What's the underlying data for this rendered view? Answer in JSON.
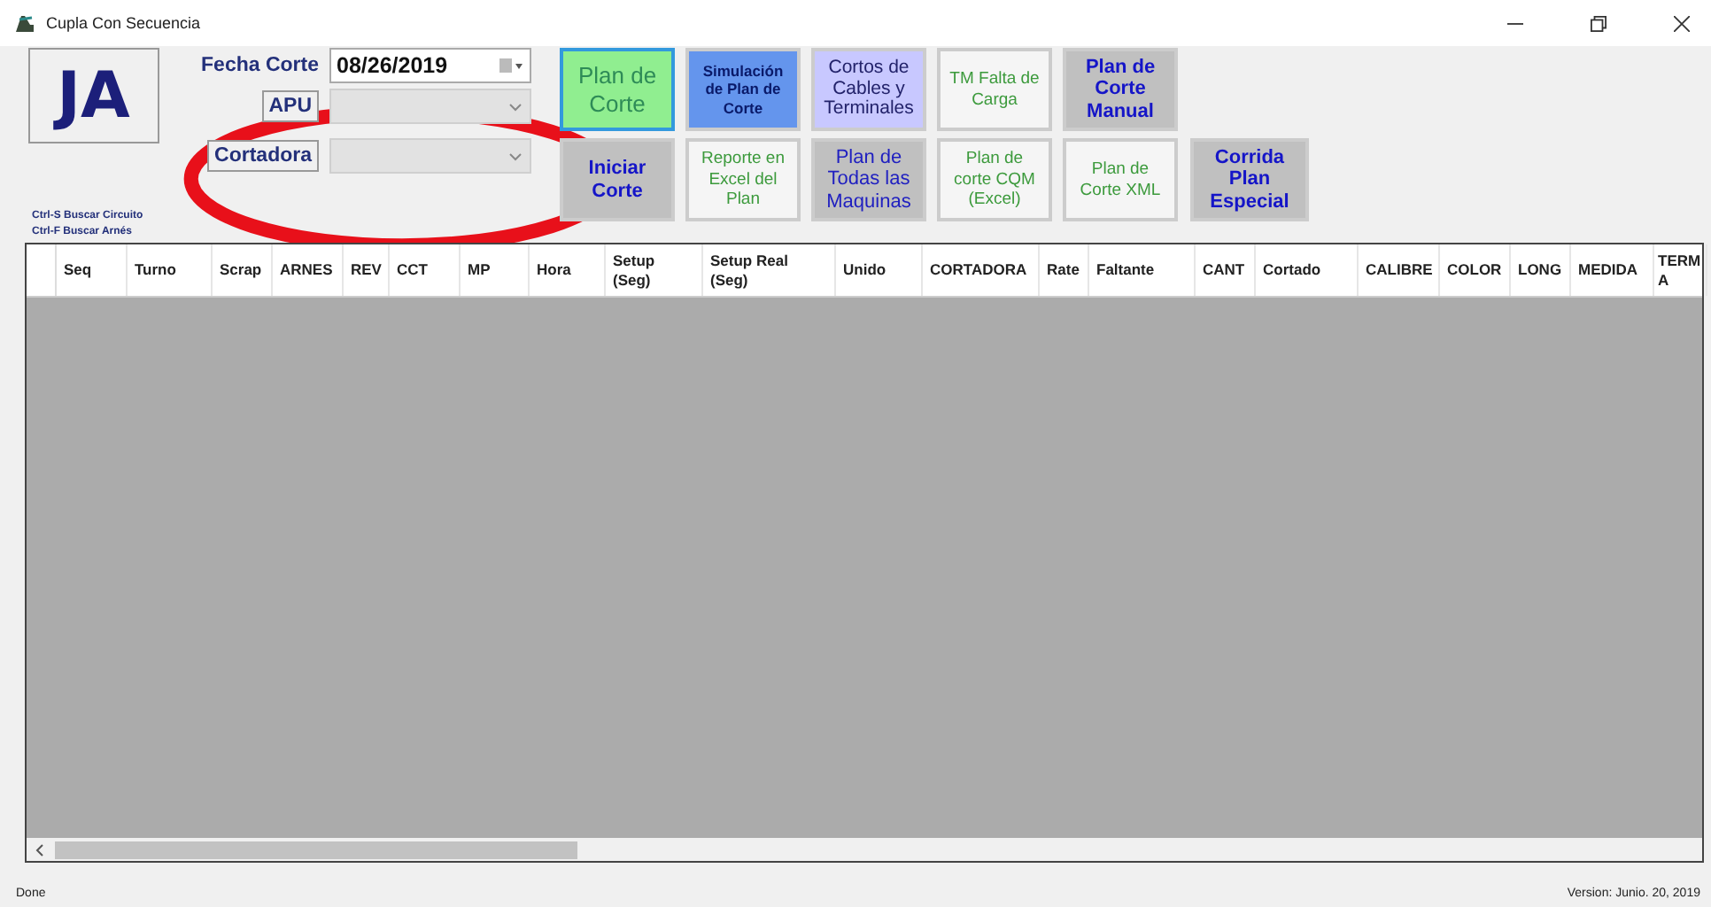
{
  "window": {
    "title": "Cupla Con Secuencia"
  },
  "logo": "JA",
  "fecha_corte": {
    "label": "Fecha Corte",
    "value": "08/26/2019"
  },
  "filters": [
    {
      "label": "APU"
    },
    {
      "label": "Cortadora"
    }
  ],
  "shortcuts": [
    "Ctrl-S Buscar Circuito",
    "Ctrl-F Buscar Arnés"
  ],
  "button_rows": [
    [
      {
        "label": "Plan de\nCorte",
        "kind": "highlight"
      },
      {
        "label": "Simulación\nde Plan de\nCorte",
        "kind": "simulation"
      },
      {
        "label": "Cortos de\nCables y\nTerminales",
        "kind": "cables"
      },
      {
        "label": "TM Falta de\nCarga",
        "kind": "report"
      },
      {
        "label": "Plan de\nCorte\nManual",
        "kind": "special"
      }
    ],
    [
      {
        "label": "Iniciar\nCorte",
        "kind": "special"
      },
      {
        "label": "Reporte en\nExcel del\nPlan",
        "kind": "report"
      },
      {
        "label": "Plan de\nTodas las\nMaquinas",
        "kind": "action"
      },
      {
        "label": "Plan de\ncorte CQM\n(Excel)",
        "kind": "report"
      },
      {
        "label": "Plan de\nCorte XML",
        "kind": "report"
      },
      {
        "label": "Corrida\nPlan\nEspecial",
        "kind": "special"
      }
    ]
  ],
  "table": {
    "columns": [
      "Seq",
      "Turno",
      "Scrap",
      "ARNES",
      "REV",
      "CCT",
      "MP",
      "Hora",
      "Setup\n(Seg)",
      "Setup Real\n(Seg)",
      "Unido",
      "CORTADORA",
      "Rate",
      "Faltante",
      "CANT",
      "Cortado",
      "CALIBRE",
      "COLOR",
      "LONG",
      "MEDIDA",
      "TERM\nA"
    ]
  },
  "status_bar": {
    "status": "Done",
    "version": "Version: Junio. 20, 2019"
  }
}
